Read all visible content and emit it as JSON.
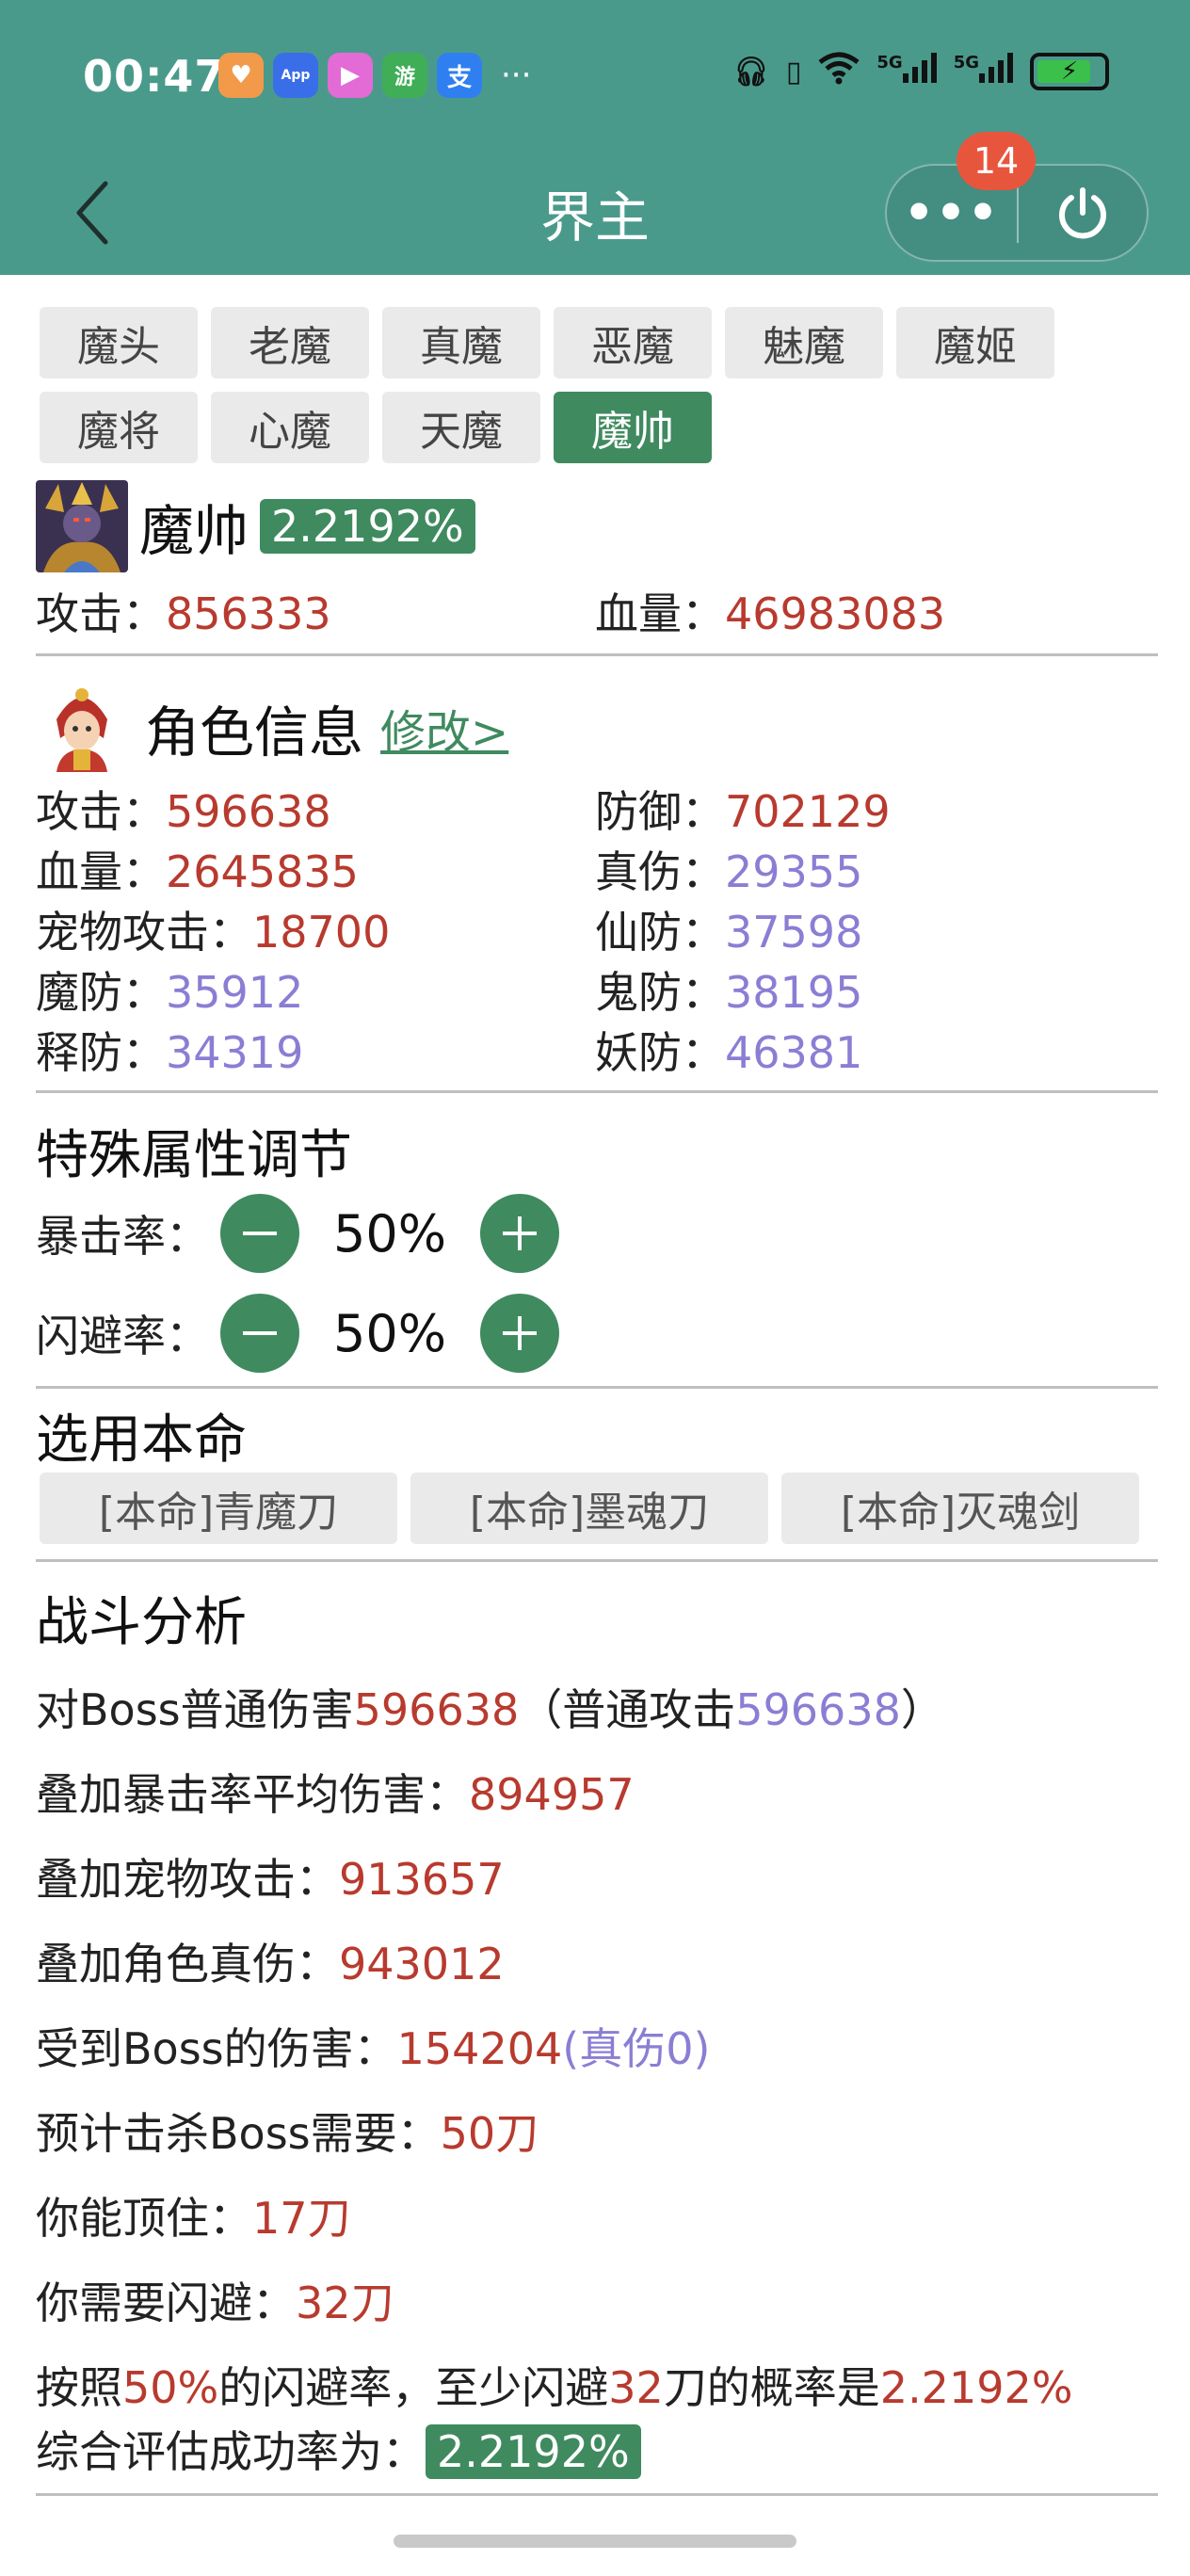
{
  "status_bar": {
    "time": "00:47",
    "app_icons": [
      "heart-app-icon",
      "app-market-icon",
      "video-app-icon",
      "game-app-icon",
      "alipay-icon"
    ],
    "network": "5G",
    "more": "···"
  },
  "header": {
    "title": "界主",
    "notification_count": "14",
    "menu_label": "•••"
  },
  "boss_tabs": [
    {
      "label": "魔头",
      "active": false
    },
    {
      "label": "老魔",
      "active": false
    },
    {
      "label": "真魔",
      "active": false
    },
    {
      "label": "恶魔",
      "active": false
    },
    {
      "label": "魅魔",
      "active": false
    },
    {
      "label": "魔姬",
      "active": false
    },
    {
      "label": "魔将",
      "active": false
    },
    {
      "label": "心魔",
      "active": false
    },
    {
      "label": "天魔",
      "active": false
    },
    {
      "label": "魔帅",
      "active": true
    }
  ],
  "boss": {
    "name": "魔帅",
    "rate": "2.2192%",
    "attack_label": "攻击：",
    "attack": "856333",
    "hp_label": "血量：",
    "hp": "46983083"
  },
  "role": {
    "title": "角色信息",
    "edit": "修改>",
    "stats": {
      "attack_label": "攻击：",
      "attack": "596638",
      "defense_label": "防御：",
      "defense": "702129",
      "hp_label": "血量：",
      "hp": "2645835",
      "true_dmg_label": "真伤：",
      "true_dmg": "29355",
      "pet_attack_label": "宠物攻击：",
      "pet_attack": "18700",
      "xian_def_label": "仙防：",
      "xian_def": "37598",
      "mo_def_label": "魔防：",
      "mo_def": "35912",
      "gui_def_label": "鬼防：",
      "gui_def": "38195",
      "shi_def_label": "释防：",
      "shi_def": "34319",
      "yao_def_label": "妖防：",
      "yao_def": "46381"
    }
  },
  "special": {
    "title": "特殊属性调节",
    "crit_label": "暴击率：",
    "crit_value": "50%",
    "dodge_label": "闪避率：",
    "dodge_value": "50%"
  },
  "benming": {
    "title": "选用本命",
    "options": [
      "[本命]青魔刀",
      "[本命]墨魂刀",
      "[本命]灭魂剑"
    ]
  },
  "analysis": {
    "title": "战斗分析",
    "line1_a": "对Boss普通伤害",
    "line1_b": "596638",
    "line1_c": "（普通攻击",
    "line1_d": "596638",
    "line1_e": "）",
    "line2_label": "叠加暴击率平均伤害：",
    "line2_value": "894957",
    "line3_label": "叠加宠物攻击：",
    "line3_value": "913657",
    "line4_label": "叠加角色真伤：",
    "line4_value": "943012",
    "line5_label": "受到Boss的伤害：",
    "line5_value": "154204",
    "line5_extra": "(真伤0)",
    "line6_label": "预计击杀Boss需要：",
    "line6_value": "50刀",
    "line7_label": "你能顶住：",
    "line7_value": "17刀",
    "line8_label": "你需要闪避：",
    "line8_value": "32刀",
    "line9_a": "按照",
    "line9_b": "50%",
    "line9_c": "的闪避率，至少闪避",
    "line9_d": "32",
    "line9_e": "刀的概率是",
    "line9_f": "2.2192%",
    "line10_label": "综合评估成功率为：",
    "line10_value": "2.2192%"
  }
}
